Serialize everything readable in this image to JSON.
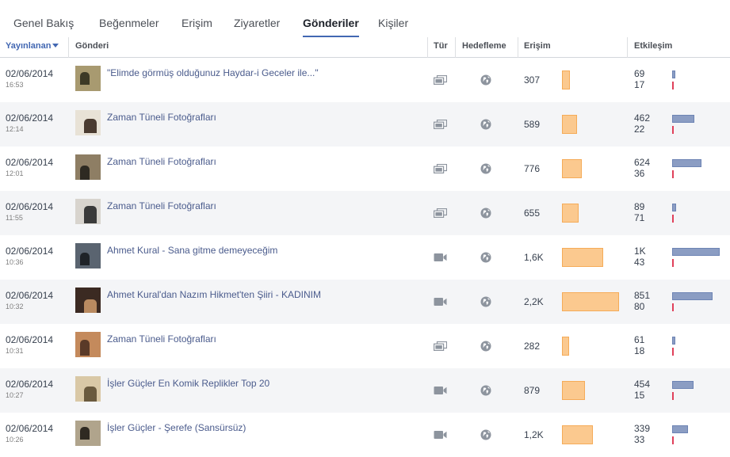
{
  "tabs": [
    {
      "label": "Genel Bakış"
    },
    {
      "label": "Beğenmeler"
    },
    {
      "label": "Erişim"
    },
    {
      "label": "Ziyaretler"
    },
    {
      "label": "Gönderiler",
      "active": true
    },
    {
      "label": "Kişiler"
    }
  ],
  "columns": {
    "published": "Yayınlanan",
    "post": "Gönderi",
    "type": "Tür",
    "targeting": "Hedefleme",
    "reach": "Erişim",
    "engagement": "Etkileşim"
  },
  "sort": {
    "column": "published",
    "direction": "desc",
    "icon": "caret-down-icon"
  },
  "colors": {
    "accent": "#4267b2",
    "reach_bar": "#fbc98f",
    "engagement_bar": "#8b9dc3",
    "engagement_bar_secondary": "#e0405a",
    "link": "#4a5b8c",
    "row_alt": "#f4f5f7"
  },
  "posts": [
    {
      "date": "02/06/2014",
      "time": "16:53",
      "title": "\"Elimde görmüş olduğunuz Haydar-i Geceler ile...\"",
      "type": "photo-album-icon",
      "targeting": "globe-icon",
      "reach": "307",
      "reach_value": 307,
      "eng_top": "69",
      "eng_top_value": 69,
      "eng_bottom": "17",
      "thumb": [
        "#a89a70",
        "#3d3a26"
      ]
    },
    {
      "date": "02/06/2014",
      "time": "12:14",
      "title": "Zaman Tüneli Fotoğrafları",
      "type": "photo-album-icon",
      "targeting": "globe-icon",
      "reach": "589",
      "reach_value": 589,
      "eng_top": "462",
      "eng_top_value": 462,
      "eng_bottom": "22",
      "thumb": [
        "#e8e2d6",
        "#4a3b30"
      ]
    },
    {
      "date": "02/06/2014",
      "time": "12:01",
      "title": "Zaman Tüneli Fotoğrafları",
      "type": "photo-album-icon",
      "targeting": "globe-icon",
      "reach": "776",
      "reach_value": 776,
      "eng_top": "624",
      "eng_top_value": 624,
      "eng_bottom": "36",
      "thumb": [
        "#8e7e64",
        "#2e2a22"
      ]
    },
    {
      "date": "02/06/2014",
      "time": "11:55",
      "title": "Zaman Tüneli Fotoğrafları",
      "type": "photo-album-icon",
      "targeting": "globe-icon",
      "reach": "655",
      "reach_value": 655,
      "eng_top": "89",
      "eng_top_value": 89,
      "eng_bottom": "71",
      "thumb": [
        "#d8d4ce",
        "#3a3a3a"
      ]
    },
    {
      "date": "02/06/2014",
      "time": "10:36",
      "title": "Ahmet Kural - Sana gitme demeyeceğim",
      "type": "video-icon",
      "targeting": "globe-icon",
      "reach": "1,6K",
      "reach_value": 1600,
      "eng_top": "1K",
      "eng_top_value": 1000,
      "eng_bottom": "43",
      "thumb": [
        "#5a6470",
        "#1f2328"
      ]
    },
    {
      "date": "02/06/2014",
      "time": "10:32",
      "title": "Ahmet Kural'dan Nazım Hikmet'ten Şiiri - KADINIM",
      "type": "video-icon",
      "targeting": "globe-icon",
      "reach": "2,2K",
      "reach_value": 2200,
      "eng_top": "851",
      "eng_top_value": 851,
      "eng_bottom": "80",
      "thumb": [
        "#3b2a22",
        "#b98a60"
      ]
    },
    {
      "date": "02/06/2014",
      "time": "10:31",
      "title": "Zaman Tüneli Fotoğrafları",
      "type": "photo-album-icon",
      "targeting": "globe-icon",
      "reach": "282",
      "reach_value": 282,
      "eng_top": "61",
      "eng_top_value": 61,
      "eng_bottom": "18",
      "thumb": [
        "#c48a5c",
        "#5a3a28"
      ]
    },
    {
      "date": "02/06/2014",
      "time": "10:27",
      "title": "İşler Güçler En Komik Replikler Top 20",
      "type": "video-icon",
      "targeting": "globe-icon",
      "reach": "879",
      "reach_value": 879,
      "eng_top": "454",
      "eng_top_value": 454,
      "eng_bottom": "15",
      "thumb": [
        "#d9c8a6",
        "#6a5a3e"
      ]
    },
    {
      "date": "02/06/2014",
      "time": "10:26",
      "title": "İşler Güçler - Şerefe (Sansürsüz)",
      "type": "video-icon",
      "targeting": "globe-icon",
      "reach": "1,2K",
      "reach_value": 1200,
      "eng_top": "339",
      "eng_top_value": 339,
      "eng_bottom": "33",
      "thumb": [
        "#b0a48c",
        "#2f2a22"
      ]
    }
  ]
}
